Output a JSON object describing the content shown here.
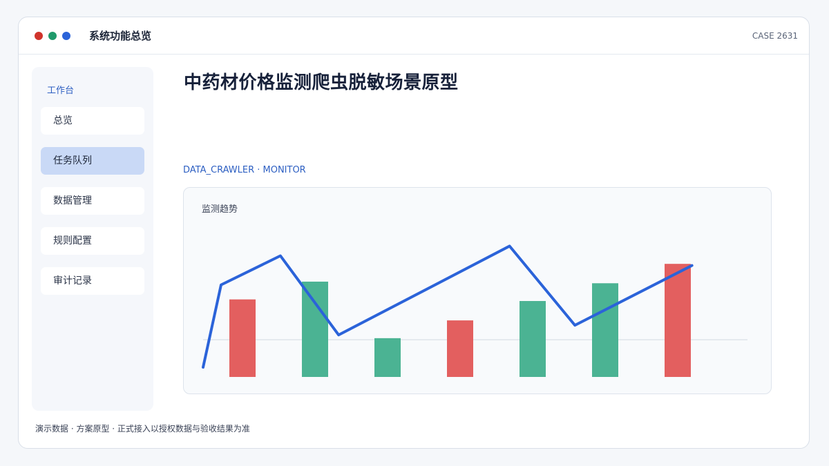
{
  "window": {
    "title": "系统功能总览",
    "case_id": "CASE 2631",
    "dots": [
      {
        "name": "close",
        "color": "#d0342c"
      },
      {
        "name": "minimize",
        "color": "#1f9a6b"
      },
      {
        "name": "maximize",
        "color": "#2b63d9"
      }
    ]
  },
  "sidebar": {
    "heading": "工作台",
    "items": [
      {
        "label": "总览",
        "active": false
      },
      {
        "label": "任务队列",
        "active": true
      },
      {
        "label": "数据管理",
        "active": false
      },
      {
        "label": "规则配置",
        "active": false
      },
      {
        "label": "审计记录",
        "active": false
      }
    ]
  },
  "main": {
    "title": "中药材价格监测爬虫脱敏场景原型",
    "section_tag": "DATA_CRAWLER · MONITOR"
  },
  "panel": {
    "title": "监测趋势"
  },
  "chart_data": {
    "type": "bar",
    "title": "监测趋势",
    "xlabel": "",
    "ylabel": "",
    "bars": [
      {
        "value": 0.48,
        "color": "#e35f5f"
      },
      {
        "value": 0.59,
        "color": "#4bb393"
      },
      {
        "value": 0.24,
        "color": "#4bb393"
      },
      {
        "value": 0.35,
        "color": "#e35f5f"
      },
      {
        "value": 0.47,
        "color": "#4bb393"
      },
      {
        "value": 0.58,
        "color": "#4bb393"
      },
      {
        "value": 0.7,
        "color": "#e35f5f"
      }
    ],
    "line": {
      "color": "#2b63d9",
      "x": [
        0,
        0.033,
        0.142,
        0.249,
        0.563,
        0.683,
        0.898
      ],
      "y": [
        0.06,
        0.57,
        0.75,
        0.26,
        0.81,
        0.32,
        0.69
      ]
    },
    "baseline": 0.23,
    "ylim": [
      0,
      1
    ],
    "grid": false,
    "legend": "none"
  },
  "footer": {
    "note": "演示数据 · 方案原型 · 正式接入以授权数据与验收结果为准"
  }
}
